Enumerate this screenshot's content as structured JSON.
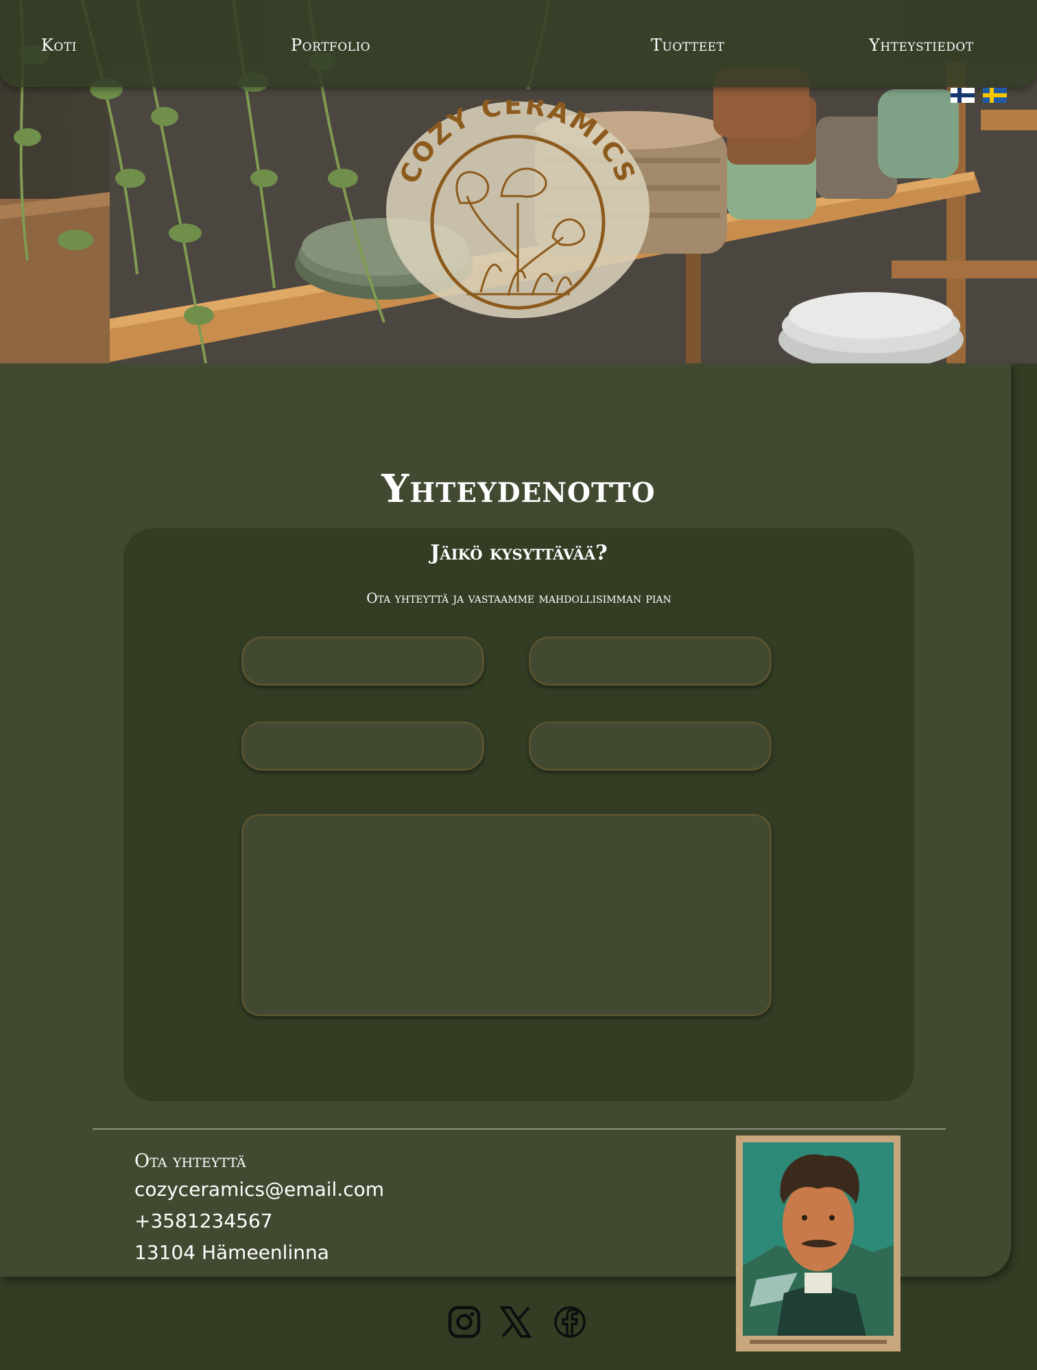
{
  "nav": {
    "items": [
      {
        "label": "Koti"
      },
      {
        "label": "Portfolio"
      },
      {
        "label": "Tuotteet"
      },
      {
        "label": "Yhteystiedot"
      }
    ]
  },
  "languages": [
    {
      "code": "fi",
      "icon": "finland-flag-icon"
    },
    {
      "code": "sv",
      "icon": "sweden-flag-icon"
    }
  ],
  "logo": {
    "text": "COZY CERAMICS",
    "icon": "flower-logo-icon"
  },
  "page": {
    "title": "Yhteydenotto"
  },
  "form": {
    "heading": "Jäikö kysyttävää?",
    "subheading": "Ota yhteyttä ja vastaamme mahdollisimman pian",
    "fields": [
      {
        "placeholder": ""
      },
      {
        "placeholder": ""
      },
      {
        "placeholder": ""
      },
      {
        "placeholder": ""
      }
    ],
    "message_placeholder": ""
  },
  "contact": {
    "title": "Ota yhteyttä",
    "email": "cozyceramics@email.com",
    "phone": "+3581234567",
    "address": "13104 Hämeenlinna"
  },
  "social": [
    {
      "icon": "instagram-icon"
    },
    {
      "icon": "x-icon"
    },
    {
      "icon": "facebook-icon"
    }
  ],
  "colors": {
    "background_dark": "#323d24",
    "panel": "#414a31",
    "field_border": "#58532f",
    "logo_brown": "#8c5a1c",
    "text": "#ffffff"
  }
}
